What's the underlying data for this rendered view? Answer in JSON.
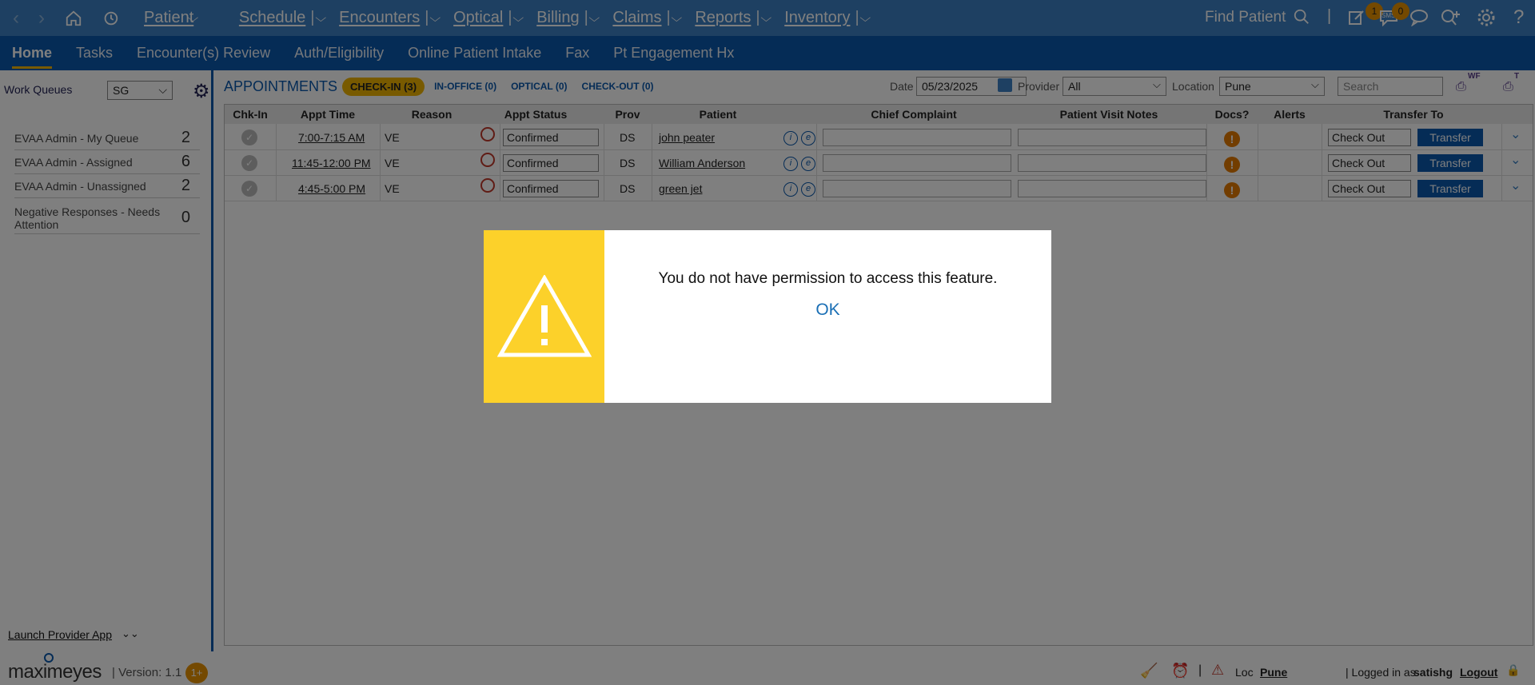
{
  "topnav": {
    "items": [
      {
        "label": "Patient"
      },
      {
        "label": "Schedule"
      },
      {
        "label": "Encounters"
      },
      {
        "label": "Optical"
      },
      {
        "label": "Billing"
      },
      {
        "label": "Claims"
      },
      {
        "label": "Reports"
      },
      {
        "label": "Inventory"
      }
    ],
    "find_patient": "Find Patient",
    "badge_tasks": "1",
    "badge_sms": "0",
    "sms_label": "SMS"
  },
  "subnav": {
    "tabs": [
      "Home",
      "Tasks",
      "Encounter(s) Review",
      "Auth/Eligibility",
      "Online Patient Intake",
      "Fax",
      "Pt Engagement Hx"
    ]
  },
  "sidebar": {
    "title": "Work Queues",
    "select_value": "SG",
    "items": [
      {
        "label": "EVAA Admin - My Queue",
        "count": "2"
      },
      {
        "label": "EVAA Admin - Assigned",
        "count": "6"
      },
      {
        "label": "EVAA Admin - Unassigned",
        "count": "2"
      },
      {
        "label": "Negative Responses - Needs Attention",
        "count": "0"
      }
    ],
    "launch": "Launch Provider App"
  },
  "appointments": {
    "title": "APPOINTMENTS",
    "tabs": {
      "checkin": "CHECK-IN (3)",
      "inoffice": "IN-OFFICE (0)",
      "optical": "OPTICAL (0)",
      "checkout": "CHECK-OUT (0)"
    },
    "date_label": "Date",
    "date_value": "05/23/2025",
    "provider_label": "Provider",
    "provider_value": "All",
    "location_label": "Location",
    "location_value": "Pune",
    "search_placeholder": "Search",
    "print_wf": "WF",
    "print_t": "T",
    "columns": [
      "Chk-In",
      "Appt Time",
      "Reason",
      "Appt Status",
      "Prov",
      "Patient",
      "Chief Complaint",
      "Patient Visit Notes",
      "Docs?",
      "Alerts",
      "Transfer To"
    ],
    "rows": [
      {
        "time": "7:00-7:15 AM",
        "reason": "VE",
        "status": "Confirmed",
        "prov": "DS",
        "patient": "john peater",
        "transfer_to": "Check Out",
        "transfer_btn": "Transfer"
      },
      {
        "time": "11:45-12:00 PM",
        "reason": "VE",
        "status": "Confirmed",
        "prov": "DS",
        "patient": "William Anderson",
        "transfer_to": "Check Out",
        "transfer_btn": "Transfer"
      },
      {
        "time": "4:45-5:00 PM",
        "reason": "VE",
        "status": "Confirmed",
        "prov": "DS",
        "patient": "green jet",
        "transfer_to": "Check Out",
        "transfer_btn": "Transfer"
      }
    ]
  },
  "footer": {
    "brand": "maximeyes",
    "version": "| Version: 1.1",
    "badge": "1+",
    "loc_label": "Loc",
    "loc_value": "Pune",
    "logged_prefix": "| Logged in as",
    "user": "satishg",
    "logout": "Logout"
  },
  "dialog": {
    "message": "You do not have permission to access this feature.",
    "ok": "OK",
    "accent": "#fcd12a"
  },
  "colors": {
    "topbar": "#3c81c4",
    "subbar": "#0a58ad",
    "accent": "#f0b400"
  }
}
